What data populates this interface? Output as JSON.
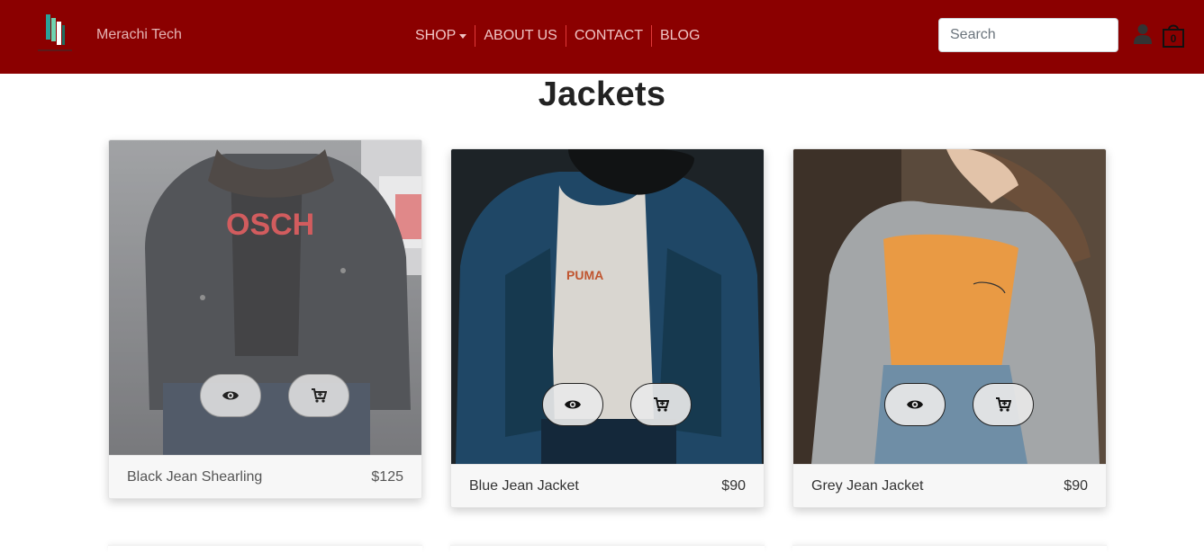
{
  "navbar": {
    "brand": "Merachi Tech",
    "links": [
      {
        "label": "SHOP",
        "has_dropdown": true
      },
      {
        "label": "ABOUT US"
      },
      {
        "label": "CONTACT"
      },
      {
        "label": "BLOG"
      }
    ],
    "search_placeholder": "Search",
    "cart_count": "0",
    "icons": [
      "logo",
      "user-icon",
      "shopping-bag-icon",
      "caret-down-icon"
    ],
    "colors": {
      "navbar_bg": "#8b0000",
      "separator": "#e03a3a"
    }
  },
  "page": {
    "title": "Jackets"
  },
  "products": [
    {
      "name": "Black Jean Shearling",
      "price": "$125",
      "icons": [
        "eye-icon",
        "cart-icon"
      ]
    },
    {
      "name": "Blue Jean Jacket",
      "price": "$90",
      "icons": [
        "eye-icon",
        "cart-icon"
      ]
    },
    {
      "name": "Grey Jean Jacket",
      "price": "$90",
      "icons": [
        "eye-icon",
        "cart-icon"
      ]
    }
  ]
}
